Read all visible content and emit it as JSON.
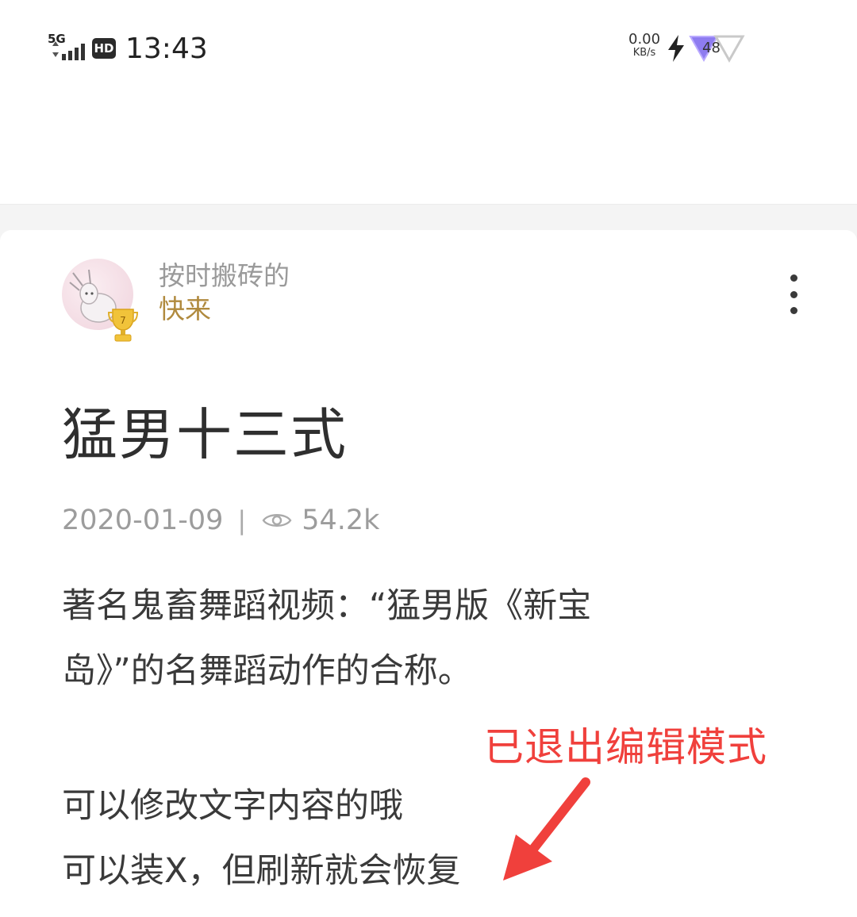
{
  "status_bar": {
    "network": "5G",
    "hd_badge": "HD",
    "time": "13:43",
    "speed_value": "0.00",
    "speed_unit": "KB/s",
    "battery": "48"
  },
  "post": {
    "author_line1": "按时搬砖的",
    "author_line2": "快来",
    "trophy_level": "7",
    "title": "猛男十三式",
    "date": "2020-01-09",
    "separator": "|",
    "views": "54.2k",
    "paragraph1_line1": "著名鬼畜舞蹈视频：“猛男版《新宝",
    "paragraph1_line2": "岛》”的名舞蹈动作的合称。",
    "paragraph2_line1": "可以修改文字内容的哦",
    "paragraph2_line2": "可以装X，但刷新就会恢复"
  },
  "annotation": {
    "text": "已退出编辑模式",
    "color": "#f0403c"
  },
  "colors": {
    "author_highlight": "#b08a3e",
    "meta_gray": "#9c9c9c"
  }
}
